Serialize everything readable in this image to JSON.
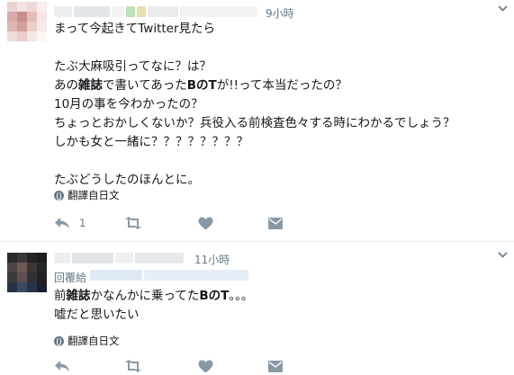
{
  "tweet1": {
    "time": "9小時",
    "lines": [
      "まって今起きてTwitter見たら",
      "",
      "たぶ大麻吸引ってなに？は？",
      "あの雑誌で書いてあったBのTが!!って本当だったの？",
      "10月の事を今わかったの？",
      "ちょっとおかしくないか？兵役入る前検査色々する時にわかるでしょう？",
      "しかも女と一緒に？？？？？？？？",
      "",
      "たぶどうしたのほんとに。"
    ],
    "translate_label": "翻譯自日文",
    "reply_count": "1",
    "colors": {
      "accent": "#657786",
      "icon": "#8899a6"
    }
  },
  "tweet2": {
    "time": "11小時",
    "reply_to_label": "回覆給",
    "lines": [
      "前雑誌かなんかに乗ってたBのT。。。",
      "嘘だと思いたい"
    ],
    "translate_label": "翻譯自日文"
  },
  "icons": {
    "caret": "chevron-down-icon",
    "reply": "reply-icon",
    "retweet": "retweet-icon",
    "like": "heart-icon",
    "message": "envelope-icon",
    "translate": "globe-icon"
  }
}
